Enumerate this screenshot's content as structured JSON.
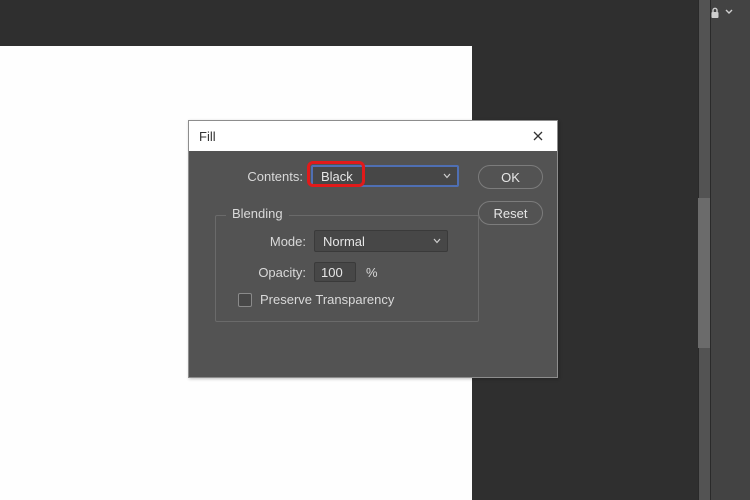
{
  "dialog": {
    "title": "Fill",
    "contents_label": "Contents:",
    "contents_value": "Black",
    "ok_label": "OK",
    "reset_label": "Reset",
    "blending": {
      "legend": "Blending",
      "mode_label": "Mode:",
      "mode_value": "Normal",
      "opacity_label": "Opacity:",
      "opacity_value": "100",
      "opacity_unit": "%",
      "preserve_label": "Preserve Transparency"
    }
  }
}
